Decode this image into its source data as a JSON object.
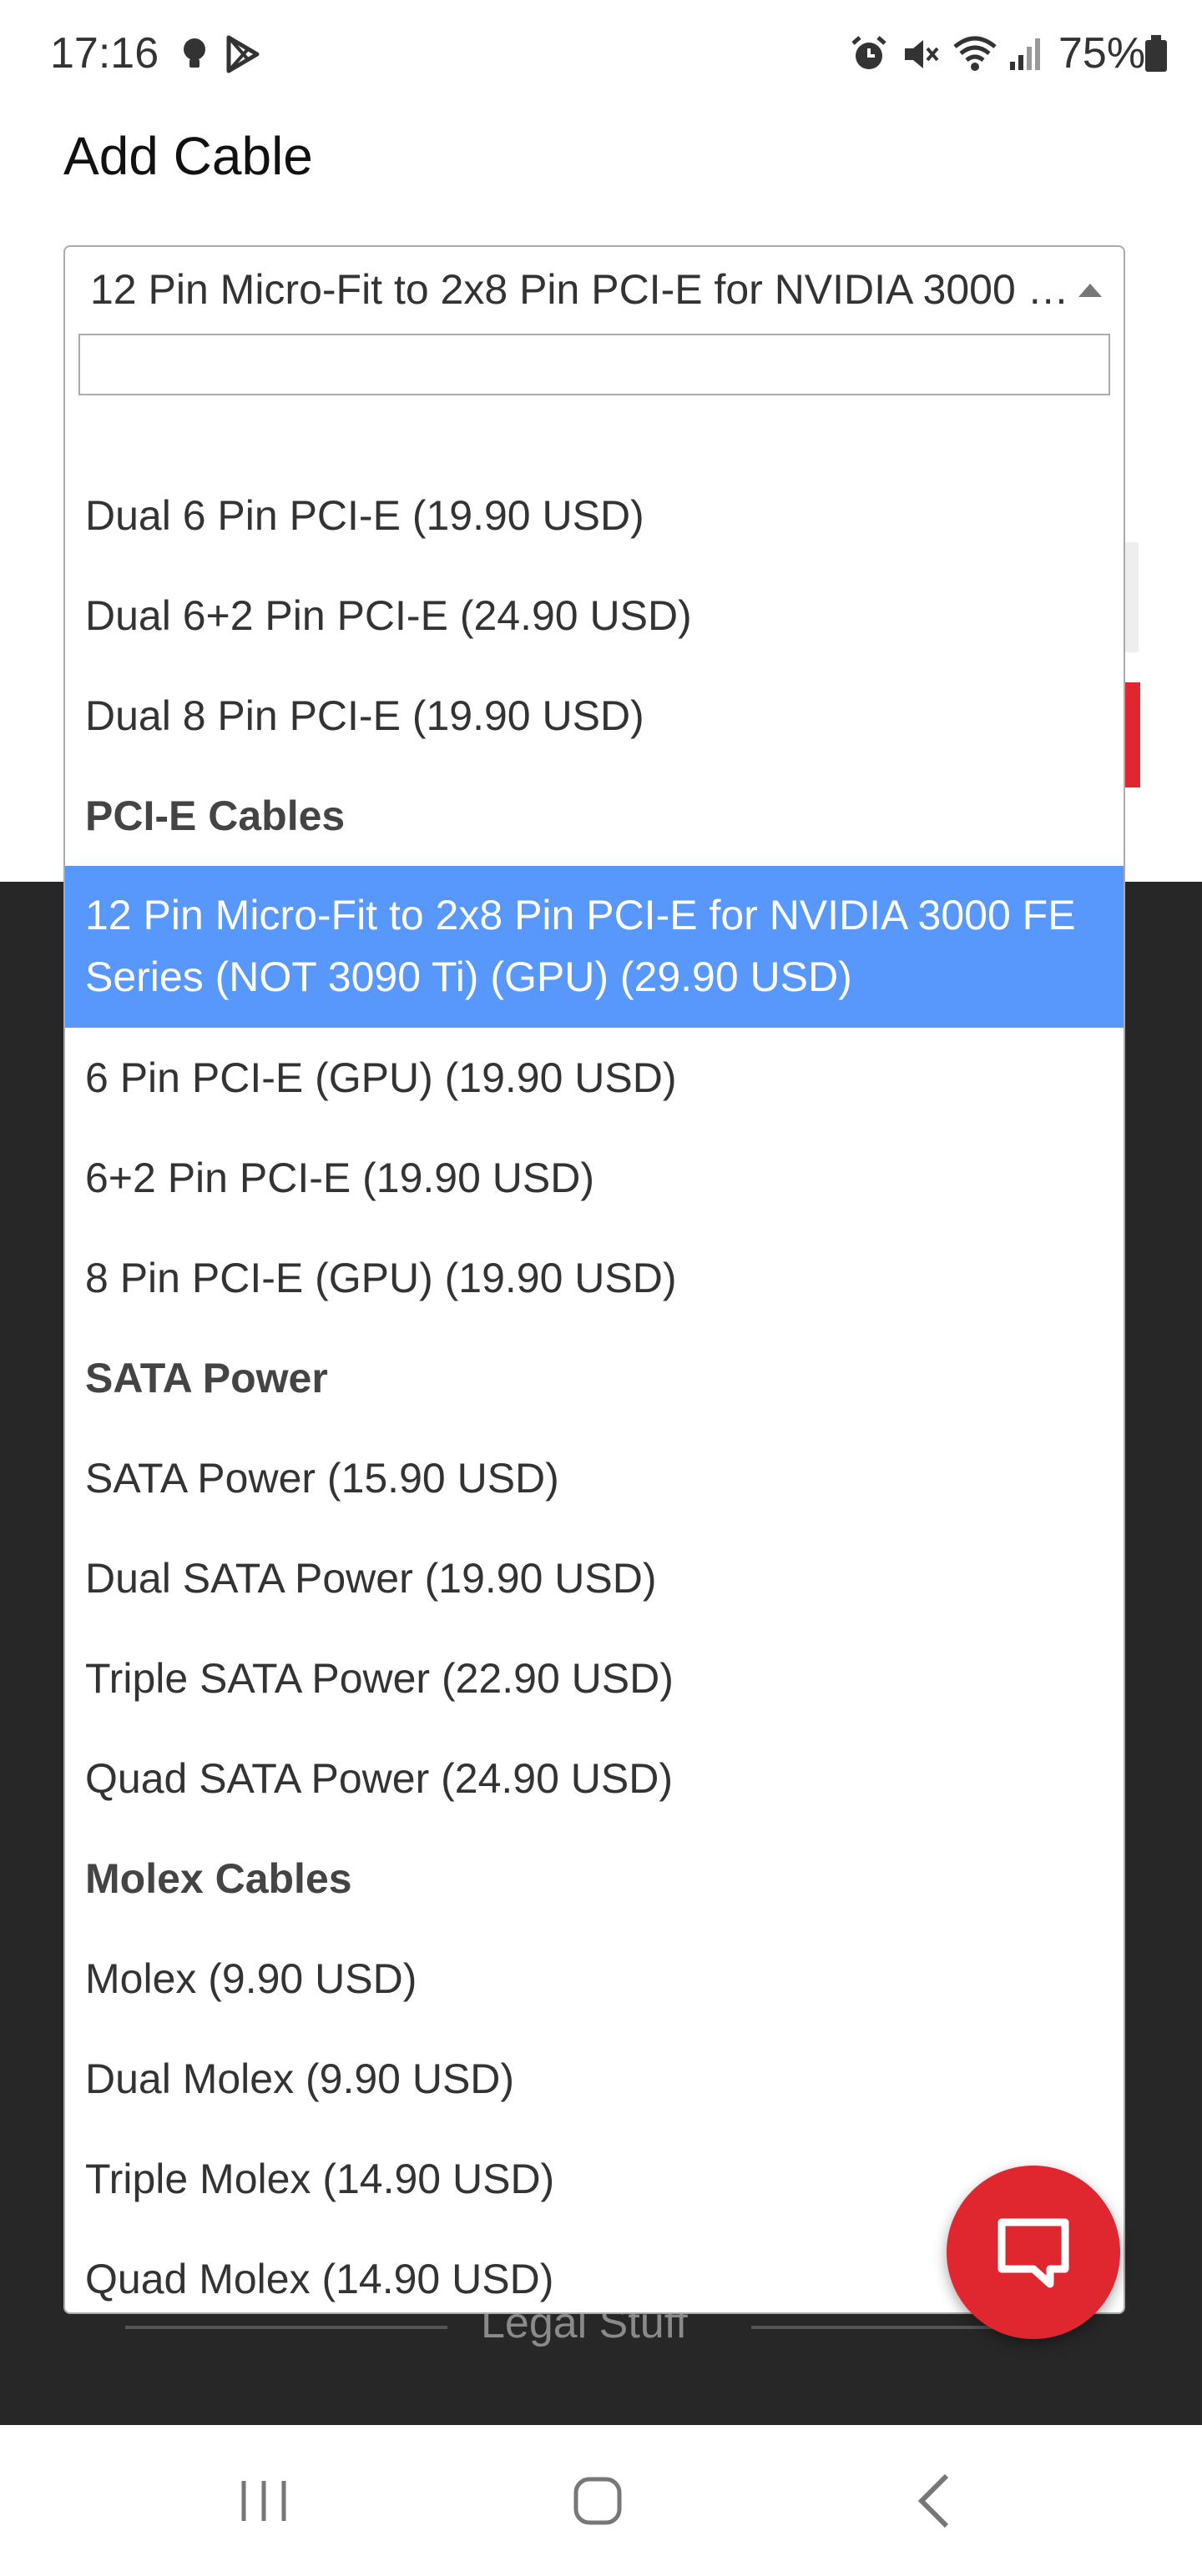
{
  "status_bar": {
    "time": "17:16",
    "battery": "75%",
    "left_icons": [
      "bulb-icon",
      "play-store-icon"
    ],
    "right_icons": [
      "alarm-icon",
      "mute-icon",
      "wifi-icon",
      "signal-icon",
      "battery-icon"
    ]
  },
  "page": {
    "title": "Add Cable"
  },
  "select": {
    "selected_value": "12 Pin Micro-Fit to 2x8 Pin PCI-E for NVIDIA 3000 FE Series (NOT 3090 Ti) (GPU) (29.90 USD)",
    "search_value": "",
    "options": [
      {
        "label": "Dual 6 Pin PCI-E (19.90 USD)",
        "type": "option"
      },
      {
        "label": "Dual 6+2 Pin PCI-E (24.90 USD)",
        "type": "option"
      },
      {
        "label": "Dual 8 Pin PCI-E (19.90 USD)",
        "type": "option"
      },
      {
        "label": "PCI-E Cables",
        "type": "group"
      },
      {
        "label": "12 Pin Micro-Fit to 2x8 Pin PCI-E for NVIDIA 3000 FE Series (NOT 3090 Ti) (GPU) (29.90 USD)",
        "type": "option",
        "highlighted": true
      },
      {
        "label": "6 Pin PCI-E (GPU) (19.90 USD)",
        "type": "option"
      },
      {
        "label": "6+2 Pin PCI-E (19.90 USD)",
        "type": "option"
      },
      {
        "label": "8 Pin PCI-E (GPU) (19.90 USD)",
        "type": "option"
      },
      {
        "label": "SATA Power",
        "type": "group"
      },
      {
        "label": "SATA Power (15.90 USD)",
        "type": "option"
      },
      {
        "label": "Dual SATA Power (19.90 USD)",
        "type": "option"
      },
      {
        "label": "Triple SATA Power (22.90 USD)",
        "type": "option"
      },
      {
        "label": "Quad SATA Power (24.90 USD)",
        "type": "option"
      },
      {
        "label": "Molex Cables",
        "type": "group"
      },
      {
        "label": "Molex (9.90 USD)",
        "type": "option"
      },
      {
        "label": "Dual Molex (9.90 USD)",
        "type": "option"
      },
      {
        "label": "Triple Molex (14.90 USD)",
        "type": "option"
      },
      {
        "label": "Quad Molex (14.90 USD)",
        "type": "option"
      }
    ]
  },
  "footer": {
    "legal_label": "Legal Stuff"
  },
  "chat": {
    "icon": "chat-bubble-icon"
  },
  "nav_bar": {
    "buttons": [
      "recent-apps-icon",
      "home-icon",
      "back-icon"
    ]
  },
  "colors": {
    "highlight": "#5897fb",
    "brand_red": "#e0262e",
    "footer_bg": "#272727"
  }
}
